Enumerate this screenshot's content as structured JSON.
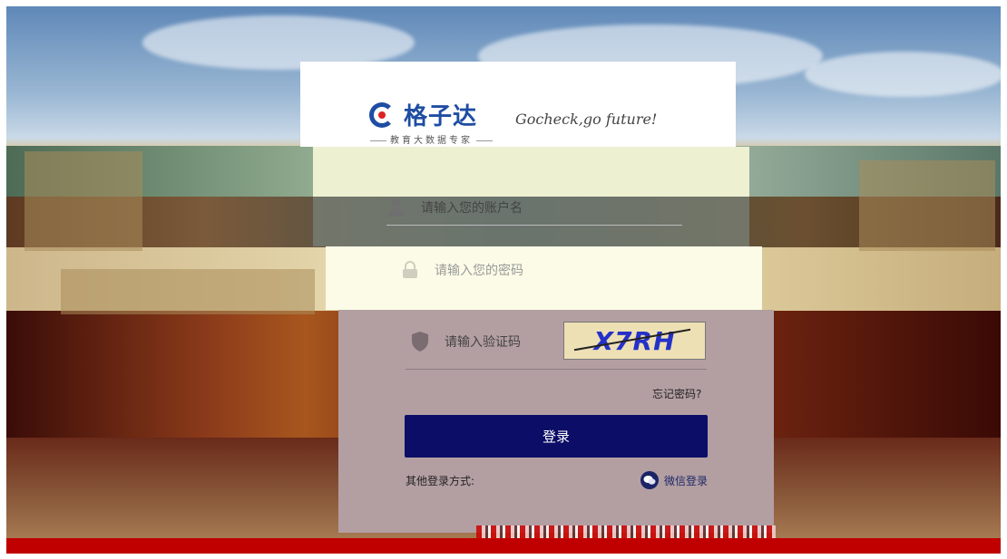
{
  "brand": {
    "name": "格子达",
    "subtitle": "教育大数据专家",
    "slogan": "Gocheck,go future!"
  },
  "form": {
    "username_placeholder": "请输入您的账户名",
    "password_placeholder": "请输入您的密码",
    "captcha_placeholder": "请输入验证码",
    "captcha_text": "X7RH",
    "forgot_label": "忘记密码?",
    "login_label": "登录",
    "other_login_label": "其他登录方式:",
    "wechat_login_label": "微信登录"
  },
  "icons": {
    "username": "user-icon",
    "password": "lock-icon",
    "captcha": "shield-icon",
    "wechat": "wechat-icon"
  },
  "colors": {
    "brand_blue": "#1f4da3",
    "login_button": "#0b0d66",
    "accent_red": "#d22222"
  }
}
